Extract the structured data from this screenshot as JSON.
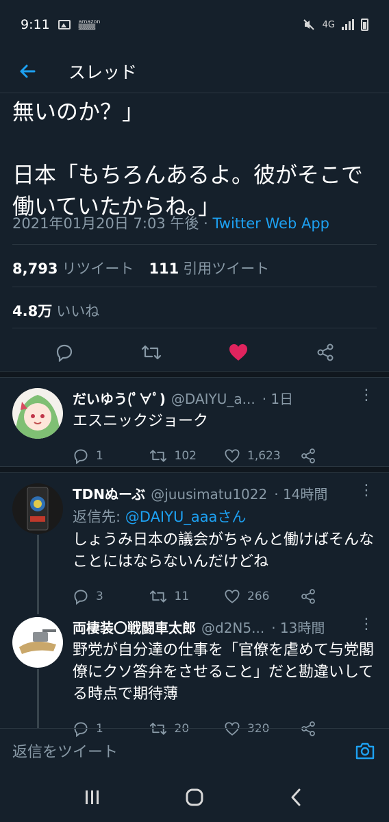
{
  "status": {
    "time": "9:11",
    "amazon": "amazon\n▒▒▒▒",
    "net": "4G"
  },
  "header": {
    "title": "スレッド"
  },
  "tweet": {
    "text": "無いのか？」\n\n日本「もちろんあるよ。彼がそこで働いていたからね。」",
    "date": "2021年01月20日 7:03 午後",
    "sep": " · ",
    "source": "Twitter Web App",
    "retweets_count": "8,793",
    "retweets_label": "リツイート",
    "quotes_count": "111",
    "quotes_label": "引用ツイート",
    "likes_count": "4.8万",
    "likes_label": "いいね"
  },
  "colors": {
    "accent": "#1da1f2",
    "like": "#e0245e",
    "bg": "#15202b",
    "muted": "#8899a6"
  },
  "replies": [
    {
      "name": "だいゆう(ﾟ∀ﾟ)",
      "handle": "@DAIYU_a...",
      "time": "· 1日",
      "reply_to_label": "",
      "reply_to_user": "",
      "text": "エスニックジョーク",
      "reply_count": "1",
      "retweet_count": "102",
      "like_count": "1,623"
    },
    {
      "name": "TDNぬーぶ",
      "handle": "@juusimatu1022",
      "time": "· 14時間",
      "reply_to_label": "返信先: ",
      "reply_to_user": "@DAIYU_aaaさん",
      "text": "しょうみ日本の議会がちゃんと働けばそんなことにはならないんだけどね",
      "reply_count": "3",
      "retweet_count": "11",
      "like_count": "266"
    },
    {
      "name": "両棲装〇戦闘車太郎",
      "handle": "@d2N5...",
      "time": "· 13時間",
      "reply_to_label": "",
      "reply_to_user": "",
      "text": "野党が自分達の仕事を「官僚を虐めて与党閣僚にクソ答弁をさせること」だと勘違いしてる時点で期待薄",
      "reply_count": "1",
      "retweet_count": "20",
      "like_count": "320"
    }
  ],
  "compose": {
    "placeholder": "返信をツイート"
  },
  "icons": [
    "back-arrow-icon",
    "reply-icon",
    "retweet-icon",
    "like-icon",
    "share-icon",
    "more-icon",
    "camera-icon",
    "recent-apps-icon",
    "home-icon",
    "back-icon"
  ]
}
